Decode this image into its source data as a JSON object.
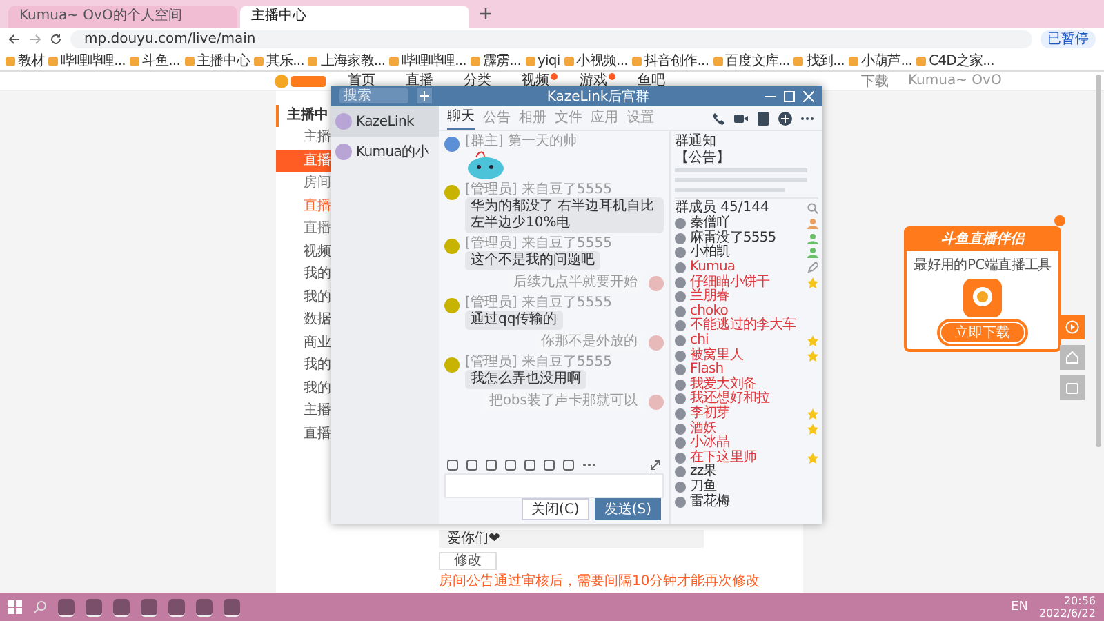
{
  "browser": {
    "tabs": [
      {
        "title": "Kumua~ OvO的个人空间",
        "selected": false
      },
      {
        "title": "主播中心",
        "selected": true
      }
    ],
    "url": "mp.douyu.com/live/main",
    "bookmarks": [
      "教材",
      "哔哩哔哩...",
      "斗鱼...",
      "主播中心",
      "其乐...",
      "上海家教...",
      "哔哩哔哩...",
      "霹雳...",
      "yiqi",
      "小视频...",
      "抖音创作...",
      "百度文库...",
      "找到...",
      "小葫芦...",
      "C4D之家..."
    ],
    "profile": "已暂停"
  },
  "site": {
    "nav": [
      {
        "label": "首页",
        "badge": false
      },
      {
        "label": "直播",
        "badge": false
      },
      {
        "label": "分类",
        "badge": false
      },
      {
        "label": "视频",
        "badge": true
      },
      {
        "label": "游戏",
        "badge": true
      },
      {
        "label": "鱼吧",
        "badge": false
      }
    ],
    "download": "下载",
    "user": "Kumua~ OvO"
  },
  "sidebar": {
    "title": "主播中",
    "items": [
      {
        "label": "主播",
        "kind": "main",
        "selected": false
      },
      {
        "label": "直播",
        "kind": "main",
        "selected": true
      },
      {
        "label": "房间",
        "kind": "sub",
        "selected": false
      },
      {
        "label": "直播",
        "kind": "sub",
        "selected": true
      },
      {
        "label": "直播",
        "kind": "sub",
        "selected": false
      },
      {
        "label": "视频",
        "kind": "main",
        "selected": false
      },
      {
        "label": "我的",
        "kind": "main",
        "selected": false
      },
      {
        "label": "我的",
        "kind": "main",
        "selected": false
      },
      {
        "label": "数据",
        "kind": "main",
        "selected": false
      },
      {
        "label": "商业",
        "kind": "main",
        "selected": false
      },
      {
        "label": "我的",
        "kind": "main",
        "selected": false
      },
      {
        "label": "我的",
        "kind": "main",
        "selected": false
      },
      {
        "label": "主播",
        "kind": "main",
        "selected": false
      },
      {
        "label": "直播",
        "kind": "main",
        "selected": false
      }
    ]
  },
  "notice_editor": {
    "value": "爱你们❤",
    "button": "修改",
    "hint": "房间公告通过审核后，需要间隔10分钟才能再次修改"
  },
  "chat_window": {
    "search": {
      "placeholder": "搜索"
    },
    "title": "KazeLink后宫群",
    "conversations": [
      {
        "name": "KazeLink",
        "selected": true
      },
      {
        "name": "Kumua的小",
        "selected": false
      }
    ],
    "tabs": [
      {
        "label": "聊天",
        "selected": true
      },
      {
        "label": "公告",
        "selected": false
      },
      {
        "label": "相册",
        "selected": false
      },
      {
        "label": "文件",
        "selected": false
      },
      {
        "label": "应用",
        "selected": false
      },
      {
        "label": "设置",
        "selected": false
      }
    ],
    "messages": [
      {
        "kind": "sticker",
        "sender": "[群主] 第一天的帅"
      },
      {
        "kind": "incoming",
        "sender": "[管理员] 来自豆了5555",
        "text": "华为的都没了 右半边耳机自比左半边少10%电"
      },
      {
        "kind": "incoming",
        "sender": "[管理员] 来自豆了5555",
        "text": "这个不是我的问题吧"
      },
      {
        "kind": "outgoing",
        "text": "后续九点半就要开始"
      },
      {
        "kind": "incoming",
        "sender": "[管理员] 来自豆了5555",
        "text": "通过qq传输的"
      },
      {
        "kind": "outgoing",
        "text": "你那不是外放的"
      },
      {
        "kind": "incoming",
        "sender": "[管理员] 来自豆了5555",
        "text": "我怎么弄也没用啊"
      },
      {
        "kind": "outgoing",
        "text": "把obs装了声卡那就可以"
      }
    ],
    "buttons": [
      {
        "label": "关闭(C)",
        "kind": "secondary"
      },
      {
        "label": "发送(S)",
        "kind": "primary"
      }
    ],
    "notice": {
      "title": "群通知",
      "label": "【公告】"
    },
    "members_header": "群成员 45/144",
    "members": [
      {
        "name": "秦僧吖",
        "color": "#333333",
        "kind": "owner"
      },
      {
        "name": "麻雷没了5555",
        "color": "#333333",
        "kind": "admin"
      },
      {
        "name": "小柏凯",
        "color": "#333333",
        "kind": "admin"
      },
      {
        "name": "Kumua",
        "color": "#e0393e",
        "kind": "self"
      },
      {
        "name": "仔细瞄小饼干",
        "color": "#e0393e",
        "kind": "starred"
      },
      {
        "name": "兰朋春",
        "color": "#e0393e",
        "kind": "plain"
      },
      {
        "name": "choko",
        "color": "#e0393e",
        "kind": "plain"
      },
      {
        "name": "不能逃过的李大车",
        "color": "#e0393e",
        "kind": "plain"
      },
      {
        "name": "chi",
        "color": "#e0393e",
        "kind": "starred"
      },
      {
        "name": "被窝里人",
        "color": "#e0393e",
        "kind": "starred"
      },
      {
        "name": "Flash",
        "color": "#e0393e",
        "kind": "plain"
      },
      {
        "name": "我爱大刘备",
        "color": "#e0393e",
        "kind": "plain"
      },
      {
        "name": "我还想好和拉",
        "color": "#e0393e",
        "kind": "plain"
      },
      {
        "name": "李初芽",
        "color": "#e0393e",
        "kind": "starred"
      },
      {
        "name": "酒妖",
        "color": "#e0393e",
        "kind": "starred"
      },
      {
        "name": "小冰晶",
        "color": "#e0393e",
        "kind": "plain"
      },
      {
        "name": "在下这里师",
        "color": "#e0393e",
        "kind": "starred"
      },
      {
        "name": "zz果",
        "color": "#333333",
        "kind": "plain"
      },
      {
        "name": "刀鱼",
        "color": "#333333",
        "kind": "plain"
      },
      {
        "name": "雷花梅",
        "color": "#333333",
        "kind": "plain"
      }
    ]
  },
  "ad": {
    "title": "斗鱼直播伴侣",
    "subtitle": "最好用的PC端直播工具",
    "button": "立即下载"
  },
  "taskbar": {
    "language": "EN",
    "time": "20:56",
    "date": "2022/6/22"
  }
}
